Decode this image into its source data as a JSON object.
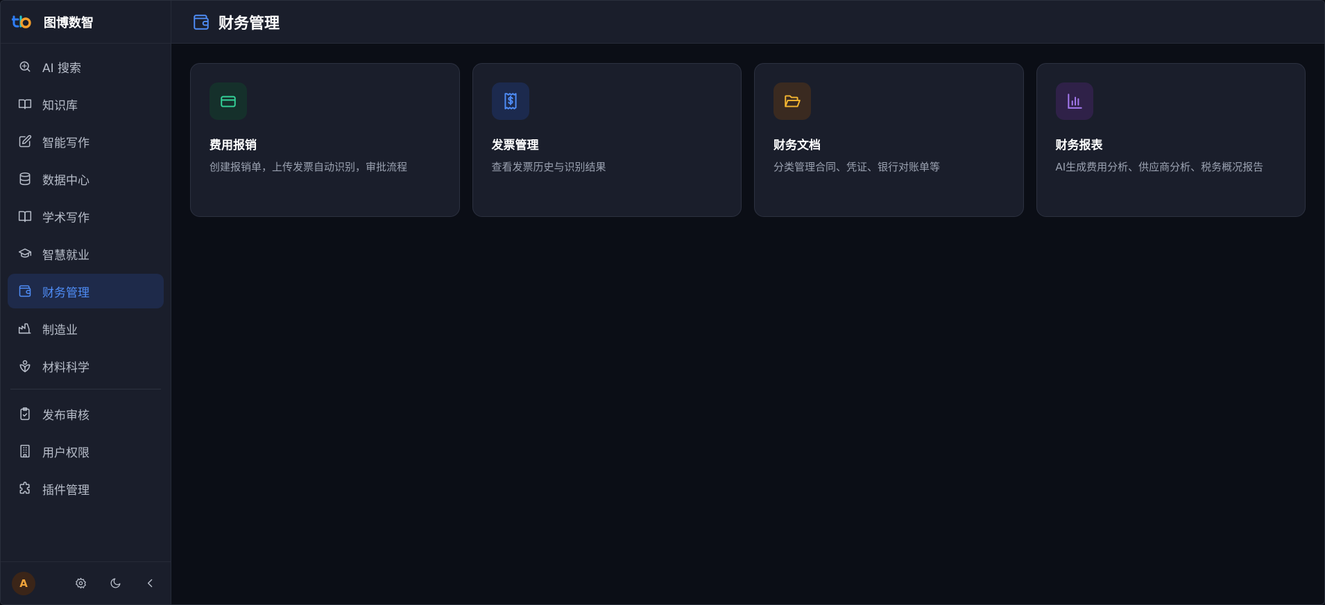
{
  "brand": {
    "name": "图博数智"
  },
  "sidebar": {
    "items": [
      {
        "label": "AI 搜索",
        "icon": "ai-search-icon",
        "active": false
      },
      {
        "label": "知识库",
        "icon": "book-open-icon",
        "active": false
      },
      {
        "label": "智能写作",
        "icon": "edit-icon",
        "active": false
      },
      {
        "label": "数据中心",
        "icon": "database-icon",
        "active": false
      },
      {
        "label": "学术写作",
        "icon": "book-icon",
        "active": false
      },
      {
        "label": "智慧就业",
        "icon": "graduation-cap-icon",
        "active": false
      },
      {
        "label": "财务管理",
        "icon": "wallet-icon",
        "active": true
      },
      {
        "label": "制造业",
        "icon": "factory-icon",
        "active": false
      },
      {
        "label": "材料科学",
        "icon": "atom-leaf-icon",
        "active": false
      }
    ],
    "admin_items": [
      {
        "label": "发布审核",
        "icon": "clipboard-check-icon"
      },
      {
        "label": "用户权限",
        "icon": "building-icon"
      },
      {
        "label": "插件管理",
        "icon": "puzzle-icon"
      }
    ],
    "footer": {
      "avatar_initial": "A"
    }
  },
  "header": {
    "title": "财务管理",
    "icon": "wallet-icon"
  },
  "cards": [
    {
      "title": "费用报销",
      "desc": "创建报销单，上传发票自动识别，审批流程",
      "icon": "credit-card-icon",
      "color": "#34d399",
      "bg": "#15302b"
    },
    {
      "title": "发票管理",
      "desc": "查看发票历史与识别结果",
      "icon": "receipt-icon",
      "color": "#4f8df7",
      "bg": "#1c2a4e"
    },
    {
      "title": "财务文档",
      "desc": "分类管理合同、凭证、银行对账单等",
      "icon": "folder-open-icon",
      "color": "#f5b731",
      "bg": "#3a2a20"
    },
    {
      "title": "财务报表",
      "desc": "AI生成费用分析、供应商分析、税务概况报告",
      "icon": "bar-chart-icon",
      "color": "#a77bf3",
      "bg": "#2f2148"
    }
  ],
  "colors": {
    "accent": "#4f8df7",
    "sidebar_bg": "#1a1e2b",
    "main_bg": "#0b0e16"
  }
}
